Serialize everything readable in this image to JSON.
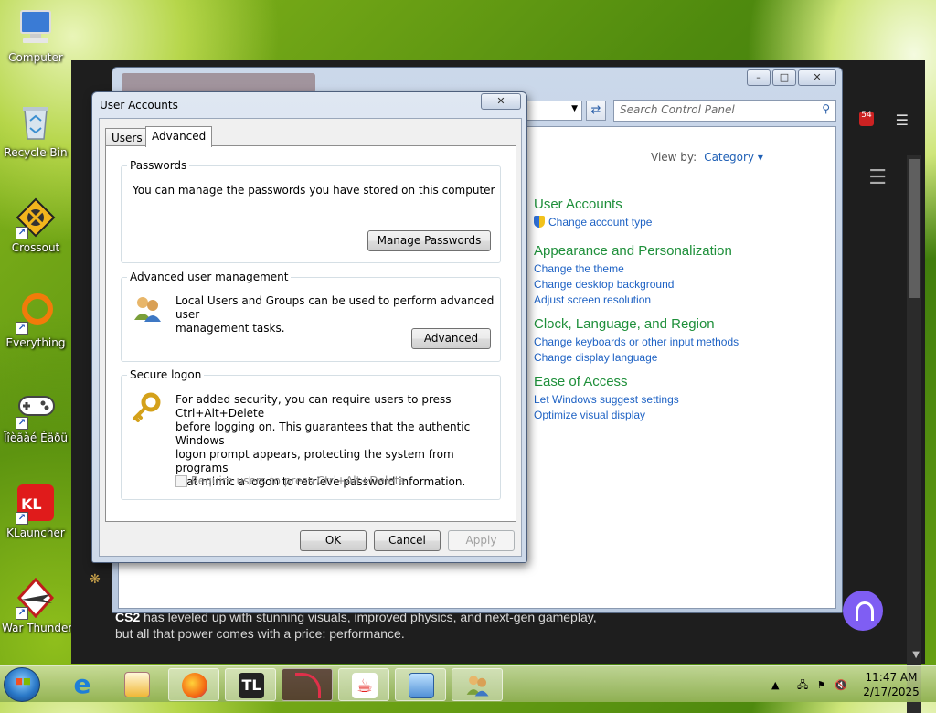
{
  "desktop": {
    "icons": [
      {
        "label": "Computer"
      },
      {
        "label": "Recycle Bin"
      },
      {
        "label": "Crossout"
      },
      {
        "label": "Everything"
      },
      {
        "label": "Ïîèãàé Éäðü"
      },
      {
        "label": "KLauncher"
      },
      {
        "label": "War Thunder"
      }
    ]
  },
  "browser_backdrop": {
    "article_bold": "CS2",
    "article_line1": " has leveled up with stunning visuals, improved physics, and next-gen gameplay,",
    "article_line2": "but all that power comes with a price: performance.",
    "notification_count": "54"
  },
  "control_panel": {
    "search_placeholder": "Search Control Panel",
    "view_by_label": "View by:",
    "view_by_value": "Category",
    "categories": [
      {
        "title": "User Accounts",
        "links": [
          "Change account type"
        ]
      },
      {
        "title": "Appearance and Personalization",
        "links": [
          "Change the theme",
          "Change desktop background",
          "Adjust screen resolution"
        ]
      },
      {
        "title": "Clock, Language, and Region",
        "links": [
          "Change keyboards or other input methods",
          "Change display language"
        ]
      },
      {
        "title": "Ease of Access",
        "links": [
          "Let Windows suggest settings",
          "Optimize visual display"
        ]
      }
    ]
  },
  "user_accounts": {
    "title": "User Accounts",
    "tabs": [
      "Users",
      "Advanced"
    ],
    "active_tab": "Advanced",
    "passwords": {
      "heading": "Passwords",
      "text": "You can manage the passwords you have stored on this computer",
      "button": "Manage Passwords"
    },
    "advanced_mgmt": {
      "heading": "Advanced user management",
      "text_line1": "Local Users and Groups can be used to perform advanced user",
      "text_line2": "management tasks.",
      "button": "Advanced"
    },
    "secure_logon": {
      "heading": "Secure logon",
      "text_line1": "For added security, you can require users to press Ctrl+Alt+Delete",
      "text_line2": "before logging on. This guarantees that the authentic Windows",
      "text_line3": "logon prompt appears, protecting the system from programs",
      "text_line4": "that mimic a logon to retrieve password information.",
      "checkbox_label": "Require users to press Ctrl+Alt+Delete",
      "checkbox_checked": false
    },
    "buttons": {
      "ok": "OK",
      "cancel": "Cancel",
      "apply": "Apply"
    }
  },
  "taskbar": {
    "time": "11:47 AM",
    "date": "2/17/2025",
    "tl_label": "TL"
  }
}
